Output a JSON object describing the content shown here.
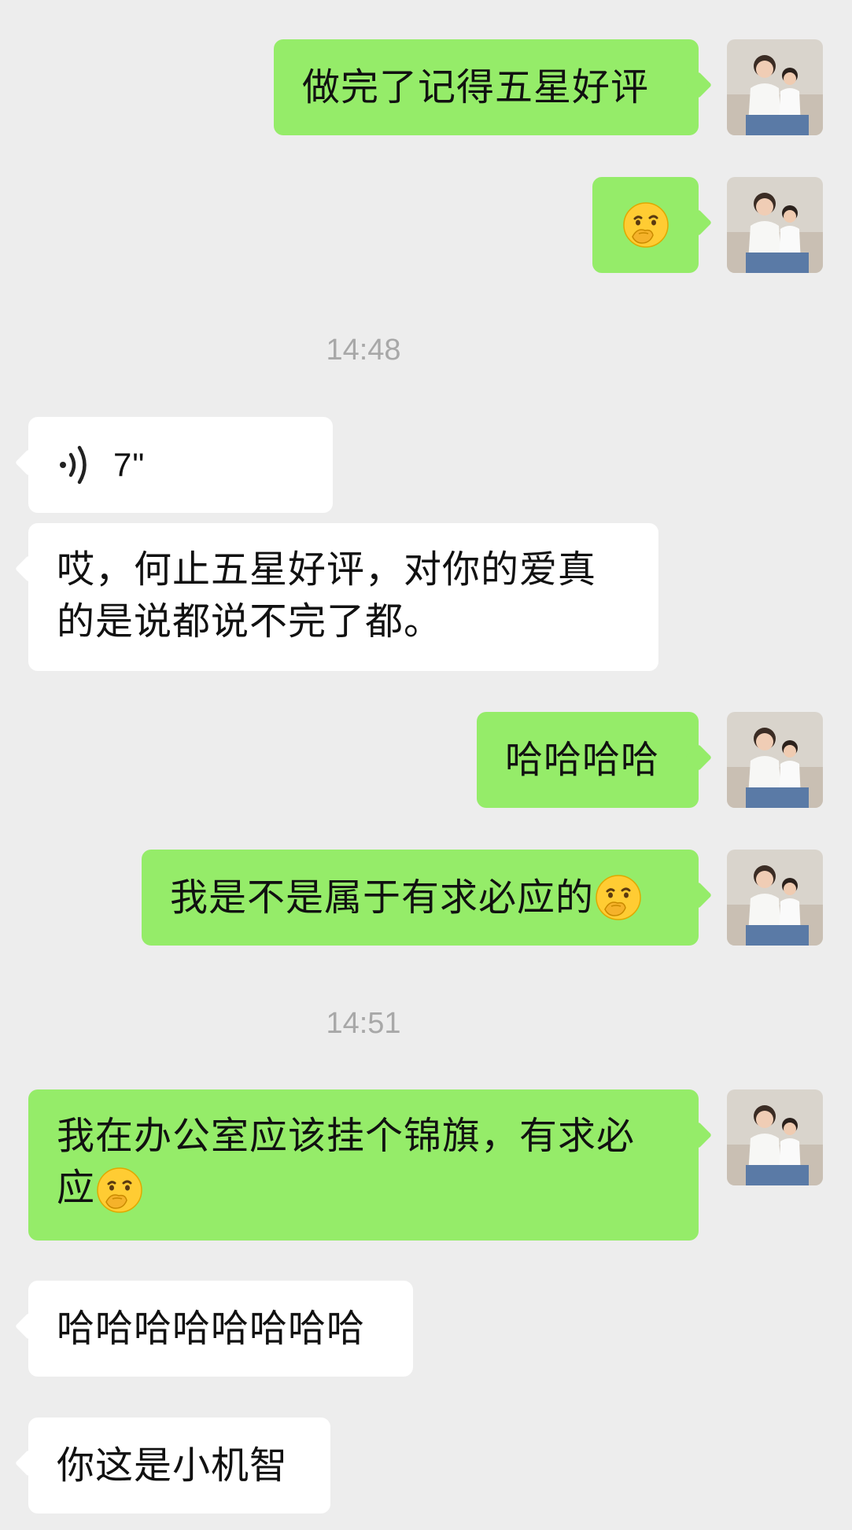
{
  "messages": {
    "m1": {
      "text": "做完了记得五星好评"
    },
    "m2": {
      "emoji": "thinking-face-hand-over-mouth"
    },
    "t1": {
      "text": "14:48"
    },
    "m3": {
      "voice_duration": "7\""
    },
    "m4": {
      "line1": "哎，何止五星好评，对你的爱真",
      "line2": "的是说都说不完了都。"
    },
    "m5": {
      "text": "哈哈哈哈"
    },
    "m6": {
      "text": "我是不是属于有求必应的"
    },
    "t2": {
      "text": "14:51"
    },
    "m7": {
      "line1": "我在办公室应该挂个锦旗，有求必",
      "line2": "应"
    },
    "m8": {
      "text": "哈哈哈哈哈哈哈哈"
    },
    "m9": {
      "text": "你这是小机智"
    }
  },
  "colors": {
    "background": "#ededed",
    "sent_bubble": "#95ec69",
    "received_bubble": "#ffffff",
    "timestamp": "#a8a8a8"
  },
  "icons": [
    "voice-icon",
    "emoji-icon",
    "avatar"
  ]
}
